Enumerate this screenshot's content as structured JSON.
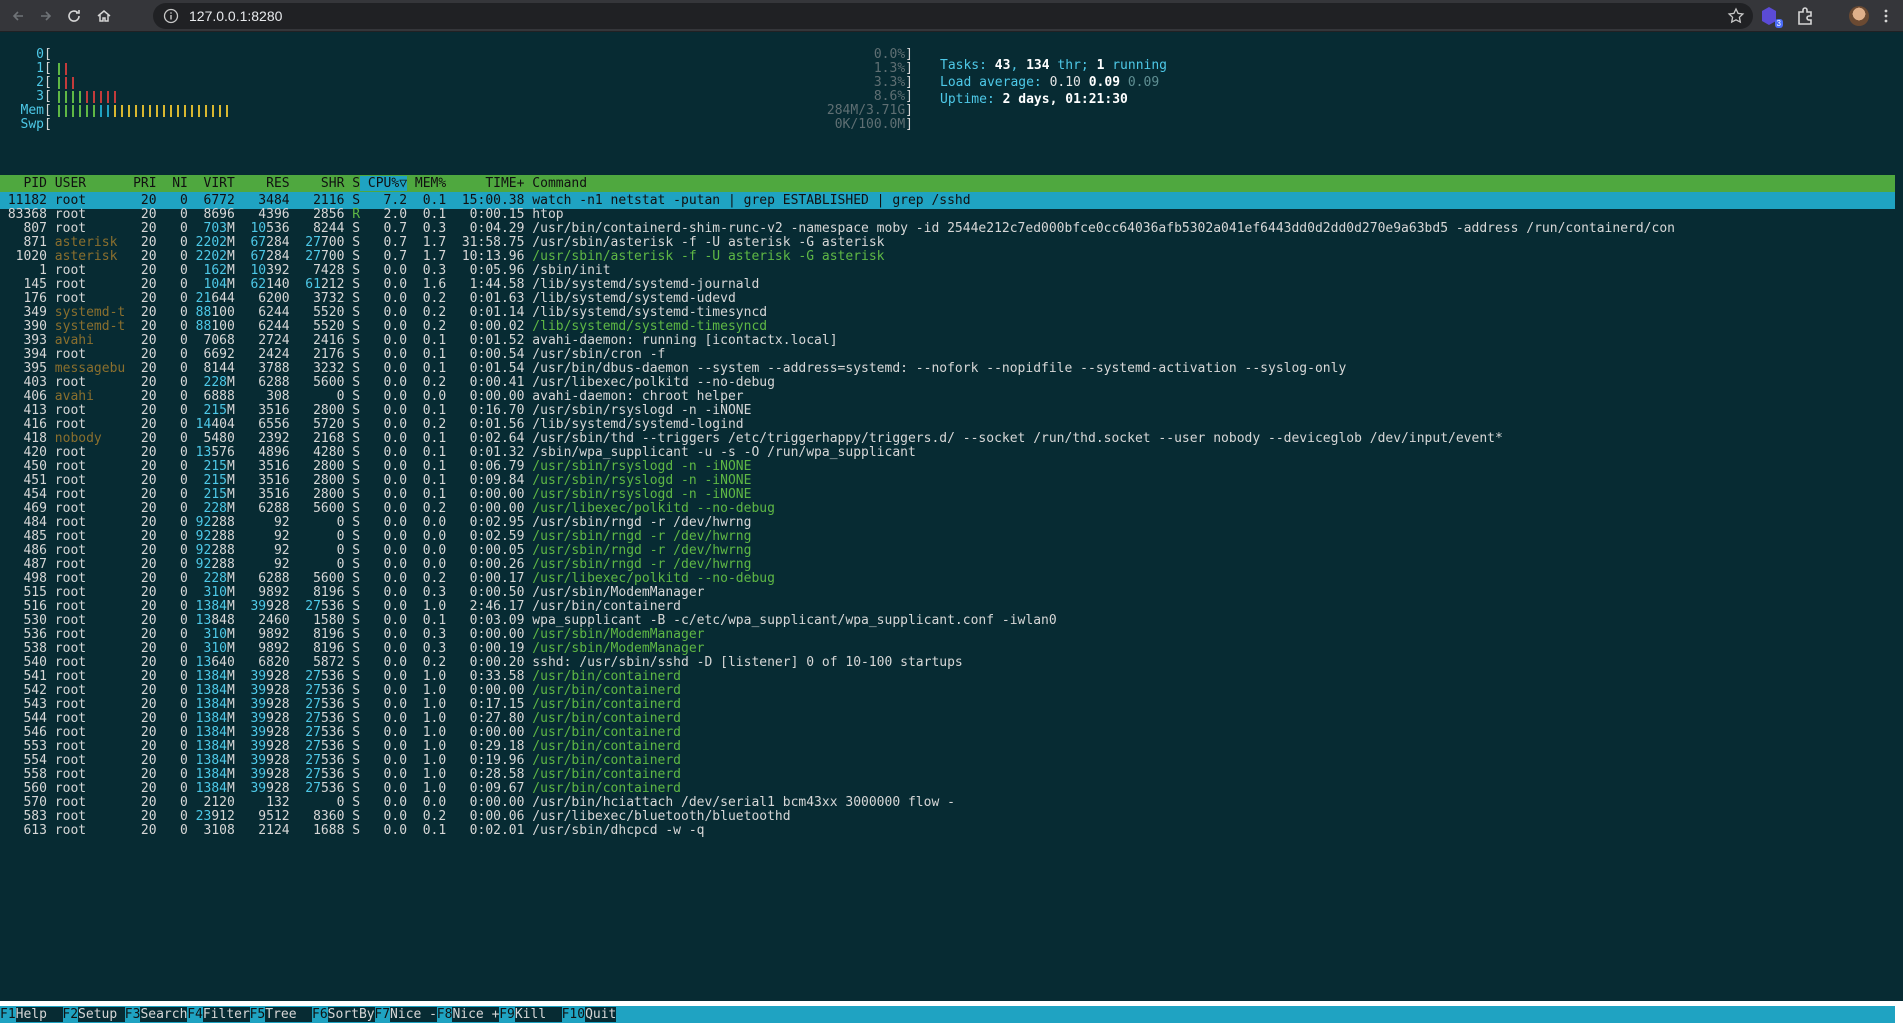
{
  "browser": {
    "url": "127.0.0.1:8280",
    "extension_badge": "3"
  },
  "meters": {
    "cpus": [
      {
        "label": "0",
        "value": "0.0%"
      },
      {
        "label": "1",
        "value": "1.3%"
      },
      {
        "label": "2",
        "value": "3.3%"
      },
      {
        "label": "3",
        "value": "8.6%"
      }
    ],
    "mem": {
      "label": "Mem",
      "value": "284M/3.71G"
    },
    "swp": {
      "label": "Swp",
      "value": "0K/100.0M"
    }
  },
  "stats": {
    "tasks_label": "Tasks: ",
    "tasks": "43",
    "sep1": ", ",
    "threads": "134",
    "thr_label": " thr; ",
    "running": "1",
    "running_label": " running",
    "load_label": "Load average: ",
    "load1": "0.10",
    "load5": "0.09",
    "load15": "0.09",
    "uptime_label": "Uptime: ",
    "uptime": "2 days, 01:21:30"
  },
  "header": {
    "pid": "PID",
    "user": "USER",
    "pri": "PRI",
    "ni": "NI",
    "virt": "VIRT",
    "res": "RES",
    "shr": "SHR",
    "s": "S",
    "cpu": "CPU%▽",
    "mem": "MEM%",
    "time": "TIME+",
    "command": "Command"
  },
  "processes": [
    {
      "pid": "11182",
      "user": "root",
      "pri": "20",
      "ni": "0",
      "virt": "6772",
      "res": "3484",
      "shr": "2116",
      "s": "S",
      "cpu": "7.2",
      "mem": "0.1",
      "time": "15:00.38",
      "cmd": "watch -n1 netstat -putan | grep ESTABLISHED | grep /sshd",
      "thread": false
    },
    {
      "pid": "83368",
      "user": "root",
      "pri": "20",
      "ni": "0",
      "virt": "8696",
      "res": "4396",
      "shr": "2856",
      "s": "R",
      "cpu": "2.0",
      "mem": "0.1",
      "time": "0:00.15",
      "cmd": "htop",
      "thread": false
    },
    {
      "pid": "807",
      "user": "root",
      "pri": "20",
      "ni": "0",
      "virt": "703M",
      "res": "10536",
      "shr": "8244",
      "s": "S",
      "cpu": "0.7",
      "mem": "0.3",
      "time": "0:04.29",
      "cmd": "/usr/bin/containerd-shim-runc-v2 -namespace moby -id 2544e212c7ed000bfce0cc64036afb5302a041ef6443dd0d2dd0d270e9a63bd5 -address /run/containerd/con",
      "thread": false
    },
    {
      "pid": "871",
      "user": "asterisk",
      "pri": "20",
      "ni": "0",
      "virt": "2202M",
      "res": "67284",
      "shr": "27700",
      "s": "S",
      "cpu": "0.7",
      "mem": "1.7",
      "time": "31:58.75",
      "cmd": "/usr/sbin/asterisk -f -U asterisk -G asterisk",
      "thread": false
    },
    {
      "pid": "1020",
      "user": "asterisk",
      "pri": "20",
      "ni": "0",
      "virt": "2202M",
      "res": "67284",
      "shr": "27700",
      "s": "S",
      "cpu": "0.7",
      "mem": "1.7",
      "time": "10:13.96",
      "cmd": "/usr/sbin/asterisk -f -U asterisk -G asterisk",
      "thread": true
    },
    {
      "pid": "1",
      "user": "root",
      "pri": "20",
      "ni": "0",
      "virt": "162M",
      "res": "10392",
      "shr": "7428",
      "s": "S",
      "cpu": "0.0",
      "mem": "0.3",
      "time": "0:05.96",
      "cmd": "/sbin/init",
      "thread": false
    },
    {
      "pid": "145",
      "user": "root",
      "pri": "20",
      "ni": "0",
      "virt": "104M",
      "res": "62140",
      "shr": "61212",
      "s": "S",
      "cpu": "0.0",
      "mem": "1.6",
      "time": "1:44.58",
      "cmd": "/lib/systemd/systemd-journald",
      "thread": false
    },
    {
      "pid": "176",
      "user": "root",
      "pri": "20",
      "ni": "0",
      "virt": "21644",
      "res": "6200",
      "shr": "3732",
      "s": "S",
      "cpu": "0.0",
      "mem": "0.2",
      "time": "0:01.63",
      "cmd": "/lib/systemd/systemd-udevd",
      "thread": false
    },
    {
      "pid": "349",
      "user": "systemd-t",
      "pri": "20",
      "ni": "0",
      "virt": "88100",
      "res": "6244",
      "shr": "5520",
      "s": "S",
      "cpu": "0.0",
      "mem": "0.2",
      "time": "0:01.14",
      "cmd": "/lib/systemd/systemd-timesyncd",
      "thread": false
    },
    {
      "pid": "390",
      "user": "systemd-t",
      "pri": "20",
      "ni": "0",
      "virt": "88100",
      "res": "6244",
      "shr": "5520",
      "s": "S",
      "cpu": "0.0",
      "mem": "0.2",
      "time": "0:00.02",
      "cmd": "/lib/systemd/systemd-timesyncd",
      "thread": true
    },
    {
      "pid": "393",
      "user": "avahi",
      "pri": "20",
      "ni": "0",
      "virt": "7068",
      "res": "2724",
      "shr": "2416",
      "s": "S",
      "cpu": "0.0",
      "mem": "0.1",
      "time": "0:01.52",
      "cmd": "avahi-daemon: running [icontactx.local]",
      "thread": false
    },
    {
      "pid": "394",
      "user": "root",
      "pri": "20",
      "ni": "0",
      "virt": "6692",
      "res": "2424",
      "shr": "2176",
      "s": "S",
      "cpu": "0.0",
      "mem": "0.1",
      "time": "0:00.54",
      "cmd": "/usr/sbin/cron -f",
      "thread": false
    },
    {
      "pid": "395",
      "user": "messagebu",
      "pri": "20",
      "ni": "0",
      "virt": "8144",
      "res": "3788",
      "shr": "3232",
      "s": "S",
      "cpu": "0.0",
      "mem": "0.1",
      "time": "0:01.54",
      "cmd": "/usr/bin/dbus-daemon --system --address=systemd: --nofork --nopidfile --systemd-activation --syslog-only",
      "thread": false
    },
    {
      "pid": "403",
      "user": "root",
      "pri": "20",
      "ni": "0",
      "virt": "228M",
      "res": "6288",
      "shr": "5600",
      "s": "S",
      "cpu": "0.0",
      "mem": "0.2",
      "time": "0:00.41",
      "cmd": "/usr/libexec/polkitd --no-debug",
      "thread": false
    },
    {
      "pid": "406",
      "user": "avahi",
      "pri": "20",
      "ni": "0",
      "virt": "6888",
      "res": "308",
      "shr": "0",
      "s": "S",
      "cpu": "0.0",
      "mem": "0.0",
      "time": "0:00.00",
      "cmd": "avahi-daemon: chroot helper",
      "thread": false
    },
    {
      "pid": "413",
      "user": "root",
      "pri": "20",
      "ni": "0",
      "virt": "215M",
      "res": "3516",
      "shr": "2800",
      "s": "S",
      "cpu": "0.0",
      "mem": "0.1",
      "time": "0:16.70",
      "cmd": "/usr/sbin/rsyslogd -n -iNONE",
      "thread": false
    },
    {
      "pid": "416",
      "user": "root",
      "pri": "20",
      "ni": "0",
      "virt": "14404",
      "res": "6556",
      "shr": "5720",
      "s": "S",
      "cpu": "0.0",
      "mem": "0.2",
      "time": "0:01.56",
      "cmd": "/lib/systemd/systemd-logind",
      "thread": false
    },
    {
      "pid": "418",
      "user": "nobody",
      "pri": "20",
      "ni": "0",
      "virt": "5480",
      "res": "2392",
      "shr": "2168",
      "s": "S",
      "cpu": "0.0",
      "mem": "0.1",
      "time": "0:02.64",
      "cmd": "/usr/sbin/thd --triggers /etc/triggerhappy/triggers.d/ --socket /run/thd.socket --user nobody --deviceglob /dev/input/event*",
      "thread": false
    },
    {
      "pid": "420",
      "user": "root",
      "pri": "20",
      "ni": "0",
      "virt": "13576",
      "res": "4896",
      "shr": "4280",
      "s": "S",
      "cpu": "0.0",
      "mem": "0.1",
      "time": "0:01.32",
      "cmd": "/sbin/wpa_supplicant -u -s -O /run/wpa_supplicant",
      "thread": false
    },
    {
      "pid": "450",
      "user": "root",
      "pri": "20",
      "ni": "0",
      "virt": "215M",
      "res": "3516",
      "shr": "2800",
      "s": "S",
      "cpu": "0.0",
      "mem": "0.1",
      "time": "0:06.79",
      "cmd": "/usr/sbin/rsyslogd -n -iNONE",
      "thread": true
    },
    {
      "pid": "451",
      "user": "root",
      "pri": "20",
      "ni": "0",
      "virt": "215M",
      "res": "3516",
      "shr": "2800",
      "s": "S",
      "cpu": "0.0",
      "mem": "0.1",
      "time": "0:09.84",
      "cmd": "/usr/sbin/rsyslogd -n -iNONE",
      "thread": true
    },
    {
      "pid": "454",
      "user": "root",
      "pri": "20",
      "ni": "0",
      "virt": "215M",
      "res": "3516",
      "shr": "2800",
      "s": "S",
      "cpu": "0.0",
      "mem": "0.1",
      "time": "0:00.00",
      "cmd": "/usr/sbin/rsyslogd -n -iNONE",
      "thread": true
    },
    {
      "pid": "469",
      "user": "root",
      "pri": "20",
      "ni": "0",
      "virt": "228M",
      "res": "6288",
      "shr": "5600",
      "s": "S",
      "cpu": "0.0",
      "mem": "0.2",
      "time": "0:00.00",
      "cmd": "/usr/libexec/polkitd --no-debug",
      "thread": true
    },
    {
      "pid": "484",
      "user": "root",
      "pri": "20",
      "ni": "0",
      "virt": "92288",
      "res": "92",
      "shr": "0",
      "s": "S",
      "cpu": "0.0",
      "mem": "0.0",
      "time": "0:02.95",
      "cmd": "/usr/sbin/rngd -r /dev/hwrng",
      "thread": false
    },
    {
      "pid": "485",
      "user": "root",
      "pri": "20",
      "ni": "0",
      "virt": "92288",
      "res": "92",
      "shr": "0",
      "s": "S",
      "cpu": "0.0",
      "mem": "0.0",
      "time": "0:02.59",
      "cmd": "/usr/sbin/rngd -r /dev/hwrng",
      "thread": true
    },
    {
      "pid": "486",
      "user": "root",
      "pri": "20",
      "ni": "0",
      "virt": "92288",
      "res": "92",
      "shr": "0",
      "s": "S",
      "cpu": "0.0",
      "mem": "0.0",
      "time": "0:00.05",
      "cmd": "/usr/sbin/rngd -r /dev/hwrng",
      "thread": true
    },
    {
      "pid": "487",
      "user": "root",
      "pri": "20",
      "ni": "0",
      "virt": "92288",
      "res": "92",
      "shr": "0",
      "s": "S",
      "cpu": "0.0",
      "mem": "0.0",
      "time": "0:00.26",
      "cmd": "/usr/sbin/rngd -r /dev/hwrng",
      "thread": true
    },
    {
      "pid": "498",
      "user": "root",
      "pri": "20",
      "ni": "0",
      "virt": "228M",
      "res": "6288",
      "shr": "5600",
      "s": "S",
      "cpu": "0.0",
      "mem": "0.2",
      "time": "0:00.17",
      "cmd": "/usr/libexec/polkitd --no-debug",
      "thread": true
    },
    {
      "pid": "515",
      "user": "root",
      "pri": "20",
      "ni": "0",
      "virt": "310M",
      "res": "9892",
      "shr": "8196",
      "s": "S",
      "cpu": "0.0",
      "mem": "0.3",
      "time": "0:00.50",
      "cmd": "/usr/sbin/ModemManager",
      "thread": false
    },
    {
      "pid": "516",
      "user": "root",
      "pri": "20",
      "ni": "0",
      "virt": "1384M",
      "res": "39928",
      "shr": "27536",
      "s": "S",
      "cpu": "0.0",
      "mem": "1.0",
      "time": "2:46.17",
      "cmd": "/usr/bin/containerd",
      "thread": false
    },
    {
      "pid": "530",
      "user": "root",
      "pri": "20",
      "ni": "0",
      "virt": "13848",
      "res": "2460",
      "shr": "1580",
      "s": "S",
      "cpu": "0.0",
      "mem": "0.1",
      "time": "0:03.09",
      "cmd": "wpa_supplicant -B -c/etc/wpa_supplicant/wpa_supplicant.conf -iwlan0",
      "thread": false
    },
    {
      "pid": "536",
      "user": "root",
      "pri": "20",
      "ni": "0",
      "virt": "310M",
      "res": "9892",
      "shr": "8196",
      "s": "S",
      "cpu": "0.0",
      "mem": "0.3",
      "time": "0:00.00",
      "cmd": "/usr/sbin/ModemManager",
      "thread": true
    },
    {
      "pid": "538",
      "user": "root",
      "pri": "20",
      "ni": "0",
      "virt": "310M",
      "res": "9892",
      "shr": "8196",
      "s": "S",
      "cpu": "0.0",
      "mem": "0.3",
      "time": "0:00.19",
      "cmd": "/usr/sbin/ModemManager",
      "thread": true
    },
    {
      "pid": "540",
      "user": "root",
      "pri": "20",
      "ni": "0",
      "virt": "13640",
      "res": "6820",
      "shr": "5872",
      "s": "S",
      "cpu": "0.0",
      "mem": "0.2",
      "time": "0:00.20",
      "cmd": "sshd: /usr/sbin/sshd -D [listener] 0 of 10-100 startups",
      "thread": false
    },
    {
      "pid": "541",
      "user": "root",
      "pri": "20",
      "ni": "0",
      "virt": "1384M",
      "res": "39928",
      "shr": "27536",
      "s": "S",
      "cpu": "0.0",
      "mem": "1.0",
      "time": "0:33.58",
      "cmd": "/usr/bin/containerd",
      "thread": true
    },
    {
      "pid": "542",
      "user": "root",
      "pri": "20",
      "ni": "0",
      "virt": "1384M",
      "res": "39928",
      "shr": "27536",
      "s": "S",
      "cpu": "0.0",
      "mem": "1.0",
      "time": "0:00.00",
      "cmd": "/usr/bin/containerd",
      "thread": true
    },
    {
      "pid": "543",
      "user": "root",
      "pri": "20",
      "ni": "0",
      "virt": "1384M",
      "res": "39928",
      "shr": "27536",
      "s": "S",
      "cpu": "0.0",
      "mem": "1.0",
      "time": "0:17.15",
      "cmd": "/usr/bin/containerd",
      "thread": true
    },
    {
      "pid": "544",
      "user": "root",
      "pri": "20",
      "ni": "0",
      "virt": "1384M",
      "res": "39928",
      "shr": "27536",
      "s": "S",
      "cpu": "0.0",
      "mem": "1.0",
      "time": "0:27.80",
      "cmd": "/usr/bin/containerd",
      "thread": true
    },
    {
      "pid": "546",
      "user": "root",
      "pri": "20",
      "ni": "0",
      "virt": "1384M",
      "res": "39928",
      "shr": "27536",
      "s": "S",
      "cpu": "0.0",
      "mem": "1.0",
      "time": "0:00.00",
      "cmd": "/usr/bin/containerd",
      "thread": true
    },
    {
      "pid": "553",
      "user": "root",
      "pri": "20",
      "ni": "0",
      "virt": "1384M",
      "res": "39928",
      "shr": "27536",
      "s": "S",
      "cpu": "0.0",
      "mem": "1.0",
      "time": "0:29.18",
      "cmd": "/usr/bin/containerd",
      "thread": true
    },
    {
      "pid": "554",
      "user": "root",
      "pri": "20",
      "ni": "0",
      "virt": "1384M",
      "res": "39928",
      "shr": "27536",
      "s": "S",
      "cpu": "0.0",
      "mem": "1.0",
      "time": "0:19.96",
      "cmd": "/usr/bin/containerd",
      "thread": true
    },
    {
      "pid": "558",
      "user": "root",
      "pri": "20",
      "ni": "0",
      "virt": "1384M",
      "res": "39928",
      "shr": "27536",
      "s": "S",
      "cpu": "0.0",
      "mem": "1.0",
      "time": "0:28.58",
      "cmd": "/usr/bin/containerd",
      "thread": true
    },
    {
      "pid": "560",
      "user": "root",
      "pri": "20",
      "ni": "0",
      "virt": "1384M",
      "res": "39928",
      "shr": "27536",
      "s": "S",
      "cpu": "0.0",
      "mem": "1.0",
      "time": "0:09.67",
      "cmd": "/usr/bin/containerd",
      "thread": true
    },
    {
      "pid": "570",
      "user": "root",
      "pri": "20",
      "ni": "0",
      "virt": "2120",
      "res": "132",
      "shr": "0",
      "s": "S",
      "cpu": "0.0",
      "mem": "0.0",
      "time": "0:00.00",
      "cmd": "/usr/bin/hciattach /dev/serial1 bcm43xx 3000000 flow -",
      "thread": false
    },
    {
      "pid": "583",
      "user": "root",
      "pri": "20",
      "ni": "0",
      "virt": "23912",
      "res": "9512",
      "shr": "8360",
      "s": "S",
      "cpu": "0.0",
      "mem": "0.2",
      "time": "0:00.06",
      "cmd": "/usr/libexec/bluetooth/bluetoothd",
      "thread": false
    },
    {
      "pid": "613",
      "user": "root",
      "pri": "20",
      "ni": "0",
      "virt": "3108",
      "res": "2124",
      "shr": "1688",
      "s": "S",
      "cpu": "0.0",
      "mem": "0.1",
      "time": "0:02.01",
      "cmd": "/usr/sbin/dhcpcd -w -q",
      "thread": false
    }
  ],
  "function_keys": [
    {
      "key": "F1",
      "label": "Help  "
    },
    {
      "key": "F2",
      "label": "Setup "
    },
    {
      "key": "F3",
      "label": "Search"
    },
    {
      "key": "F4",
      "label": "Filter"
    },
    {
      "key": "F5",
      "label": "Tree  "
    },
    {
      "key": "F6",
      "label": "SortBy"
    },
    {
      "key": "F7",
      "label": "Nice -"
    },
    {
      "key": "F8",
      "label": "Nice +"
    },
    {
      "key": "F9",
      "label": "Kill  "
    },
    {
      "key": "F10",
      "label": "Quit"
    }
  ],
  "colors": {
    "background": "#072b33",
    "header_green": "#4fa83f",
    "selection_cyan": "#1fa3c2",
    "thread_green": "#5fb845",
    "user_dim": "#8a6f2e"
  }
}
